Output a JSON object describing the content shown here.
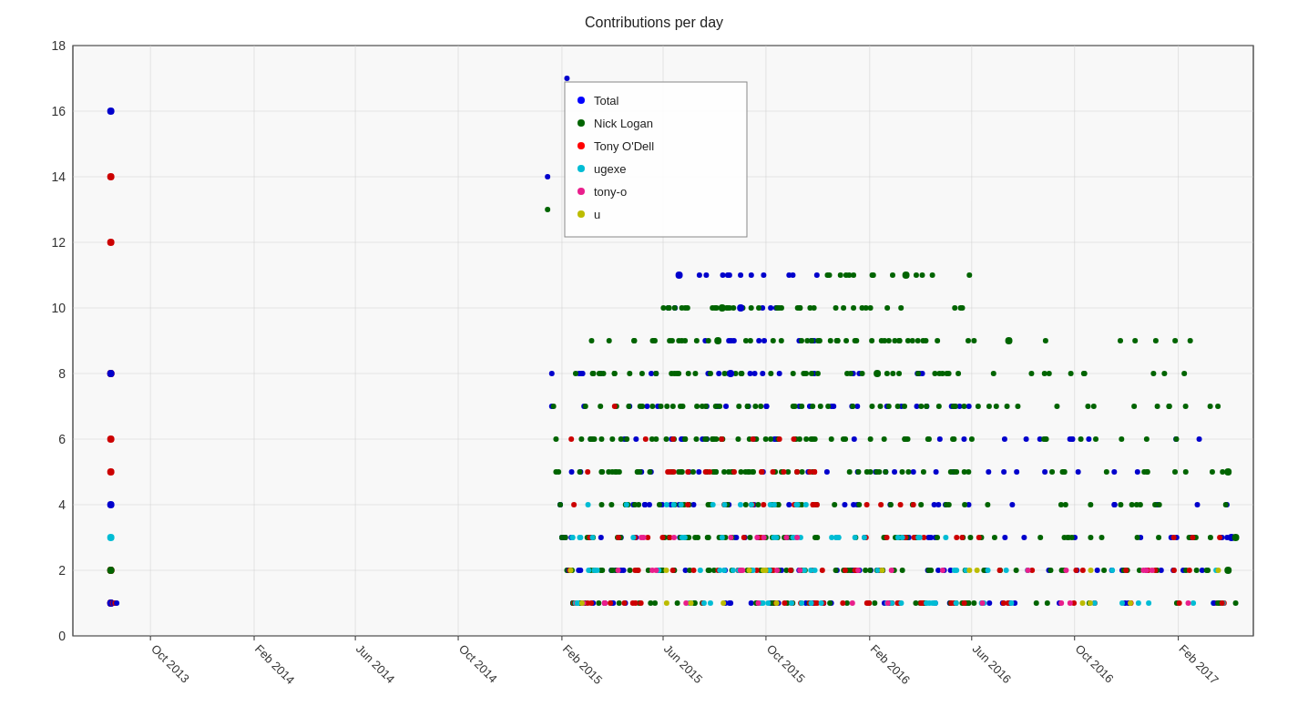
{
  "chart": {
    "title": "Contributions per day",
    "x_axis": {
      "labels": [
        "Oct 2013",
        "Feb 2014",
        "Jun 2014",
        "Oct 2014",
        "Feb 2015",
        "Jun 2015",
        "Oct 2015",
        "Feb 2016",
        "Jun 2016",
        "Oct 2016",
        "Feb 2017"
      ]
    },
    "y_axis": {
      "min": 0,
      "max": 18,
      "ticks": [
        0,
        2,
        4,
        6,
        8,
        10,
        12,
        14,
        16,
        18
      ]
    },
    "legend": {
      "items": [
        {
          "label": "Total",
          "color": "#0000ff"
        },
        {
          "label": "Nick Logan",
          "color": "#006400"
        },
        {
          "label": "Tony O'Dell",
          "color": "#ff0000"
        },
        {
          "label": "ugexe",
          "color": "#00bcd4"
        },
        {
          "label": "tony-o",
          "color": "#e91e8c"
        },
        {
          "label": "u",
          "color": "#bcbc00"
        }
      ]
    }
  }
}
